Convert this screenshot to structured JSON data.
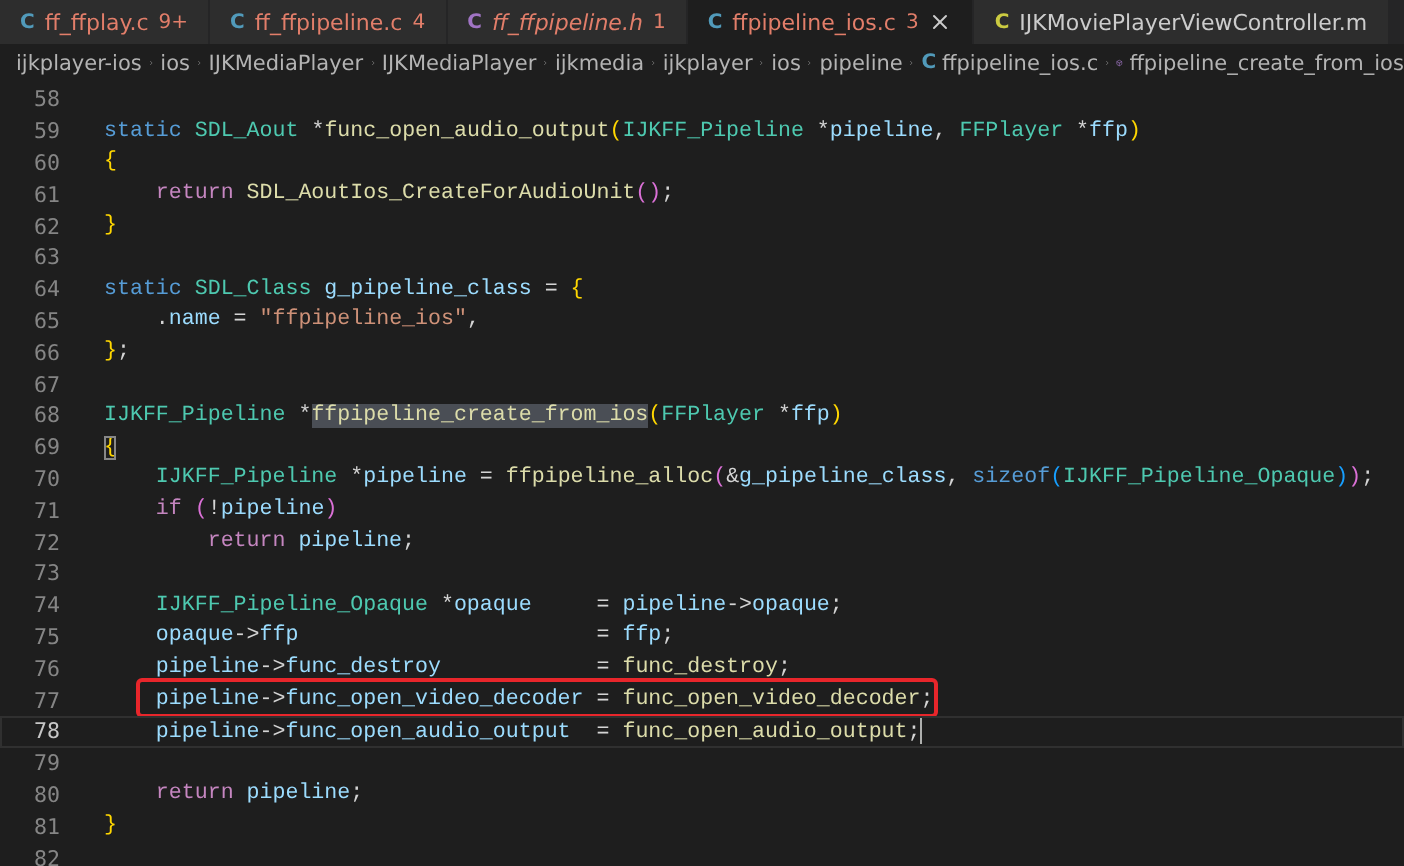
{
  "tabs": [
    {
      "icon": "C",
      "kind": "c",
      "label": "ff_ffplay.c",
      "badge": "9+",
      "has_problems": true,
      "preview": false,
      "selected": false
    },
    {
      "icon": "C",
      "kind": "c",
      "label": "ff_ffpipeline.c",
      "badge": "4",
      "has_problems": true,
      "preview": false,
      "selected": false
    },
    {
      "icon": "C",
      "kind": "h",
      "label": "ff_ffpipeline.h",
      "badge": "1",
      "has_problems": true,
      "preview": true,
      "selected": false
    },
    {
      "icon": "C",
      "kind": "c",
      "label": "ffpipeline_ios.c",
      "badge": "3",
      "has_problems": true,
      "preview": false,
      "selected": true
    },
    {
      "icon": "C",
      "kind": "m",
      "label": "IJKMoviePlayerViewController.m",
      "has_problems": false,
      "preview": false,
      "selected": false
    }
  ],
  "breadcrumb": [
    {
      "kind": "folder",
      "label": "ijkplayer-ios"
    },
    {
      "kind": "folder",
      "label": "ios"
    },
    {
      "kind": "folder",
      "label": "IJKMediaPlayer"
    },
    {
      "kind": "folder",
      "label": "IJKMediaPlayer"
    },
    {
      "kind": "folder",
      "label": "ijkmedia"
    },
    {
      "kind": "folder",
      "label": "ijkplayer"
    },
    {
      "kind": "folder",
      "label": "ios"
    },
    {
      "kind": "folder",
      "label": "pipeline"
    },
    {
      "kind": "file",
      "icon": "C",
      "label": "ffpipeline_ios.c"
    },
    {
      "kind": "symbol",
      "label": "ffpipeline_create_from_ios"
    }
  ],
  "lines": [
    {
      "n": "58",
      "current": false,
      "annotated": false
    },
    {
      "n": "59",
      "current": false,
      "annotated": false,
      "tokens": [
        {
          "text": "static",
          "kind": "kw"
        },
        {
          "text": " SDL_Aout",
          "kind": "type"
        },
        {
          "text": " *",
          "kind": "p"
        },
        {
          "text": "func_open_audio_output",
          "kind": "fn"
        },
        {
          "text": "(",
          "kind": "b1"
        },
        {
          "text": "IJKFF_Pipeline",
          "kind": "type"
        },
        {
          "text": " *",
          "kind": "p"
        },
        {
          "text": "pipeline",
          "kind": "var"
        },
        {
          "text": ",",
          "kind": "p"
        },
        {
          "text": " FFPlayer",
          "kind": "type"
        },
        {
          "text": " *",
          "kind": "p"
        },
        {
          "text": "ffp",
          "kind": "var"
        },
        {
          "text": ")",
          "kind": "b1"
        }
      ]
    },
    {
      "n": "60",
      "current": false,
      "annotated": false,
      "tokens": [
        {
          "text": "{",
          "kind": "b1"
        }
      ]
    },
    {
      "n": "61",
      "current": false,
      "annotated": false,
      "tokens": [
        {
          "text": "    return",
          "kind": "ctl"
        },
        {
          "text": " SDL_AoutIos_CreateForAudioUnit",
          "kind": "fn"
        },
        {
          "text": "()",
          "kind": "b2"
        },
        {
          "text": ";",
          "kind": "p"
        }
      ]
    },
    {
      "n": "62",
      "current": false,
      "annotated": false,
      "tokens": [
        {
          "text": "}",
          "kind": "b1"
        }
      ]
    },
    {
      "n": "63",
      "current": false,
      "annotated": false
    },
    {
      "n": "64",
      "current": false,
      "annotated": false,
      "tokens": [
        {
          "text": "static",
          "kind": "kw"
        },
        {
          "text": " SDL_Class",
          "kind": "type"
        },
        {
          "text": " g_pipeline_class",
          "kind": "var"
        },
        {
          "text": " =",
          "kind": "p"
        },
        {
          "text": " {",
          "kind": "b1"
        }
      ]
    },
    {
      "n": "65",
      "current": false,
      "annotated": false,
      "tokens": [
        {
          "text": "    .",
          "kind": "p"
        },
        {
          "text": "name",
          "kind": "var"
        },
        {
          "text": " =",
          "kind": "p"
        },
        {
          "text": " \"ffpipeline_ios\"",
          "kind": "str"
        },
        {
          "text": ",",
          "kind": "p"
        }
      ]
    },
    {
      "n": "66",
      "current": false,
      "annotated": false,
      "tokens": [
        {
          "text": "}",
          "kind": "b1"
        },
        {
          "text": ";",
          "kind": "p"
        }
      ]
    },
    {
      "n": "67",
      "current": false,
      "annotated": false
    },
    {
      "n": "68",
      "current": false,
      "annotated": false,
      "tokens": [
        {
          "text": "IJKFF_Pipeline",
          "kind": "type"
        },
        {
          "text": " *",
          "kind": "p"
        },
        {
          "text": "ffpipeline_create_from_ios",
          "kind": "sel"
        },
        {
          "text": "(",
          "kind": "b1"
        },
        {
          "text": "FFPlayer",
          "kind": "type"
        },
        {
          "text": " *",
          "kind": "p"
        },
        {
          "text": "ffp",
          "kind": "var"
        },
        {
          "text": ")",
          "kind": "b1"
        }
      ]
    },
    {
      "n": "69",
      "current": false,
      "annotated": false,
      "tokens": [
        {
          "text": "{",
          "kind": "match"
        }
      ]
    },
    {
      "n": "70",
      "current": false,
      "annotated": false,
      "tokens": [
        {
          "text": "    IJKFF_Pipeline",
          "kind": "type"
        },
        {
          "text": " *",
          "kind": "p"
        },
        {
          "text": "pipeline",
          "kind": "var"
        },
        {
          "text": " =",
          "kind": "p"
        },
        {
          "text": " ffpipeline_alloc",
          "kind": "fn"
        },
        {
          "text": "(",
          "kind": "b2"
        },
        {
          "text": "&",
          "kind": "p"
        },
        {
          "text": "g_pipeline_class",
          "kind": "var"
        },
        {
          "text": ",",
          "kind": "p"
        },
        {
          "text": " sizeof",
          "kind": "kw"
        },
        {
          "text": "(",
          "kind": "b3"
        },
        {
          "text": "IJKFF_Pipeline_Opaque",
          "kind": "type"
        },
        {
          "text": ")",
          "kind": "b3"
        },
        {
          "text": ")",
          "kind": "b2"
        },
        {
          "text": ";",
          "kind": "p"
        }
      ]
    },
    {
      "n": "71",
      "current": false,
      "annotated": false,
      "tokens": [
        {
          "text": "    if",
          "kind": "ctl"
        },
        {
          "text": " (",
          "kind": "b2"
        },
        {
          "text": "!",
          "kind": "p"
        },
        {
          "text": "pipeline",
          "kind": "var"
        },
        {
          "text": ")",
          "kind": "b2"
        }
      ]
    },
    {
      "n": "72",
      "current": false,
      "annotated": false,
      "tokens": [
        {
          "text": "        return",
          "kind": "ctl"
        },
        {
          "text": " pipeline",
          "kind": "var"
        },
        {
          "text": ";",
          "kind": "p"
        }
      ]
    },
    {
      "n": "73",
      "current": false,
      "annotated": false
    },
    {
      "n": "74",
      "current": false,
      "annotated": false,
      "tokens": [
        {
          "text": "    IJKFF_Pipeline_Opaque",
          "kind": "type"
        },
        {
          "text": " *",
          "kind": "p"
        },
        {
          "text": "opaque",
          "kind": "var"
        },
        {
          "text": "     =",
          "kind": "p"
        },
        {
          "text": " pipeline",
          "kind": "var"
        },
        {
          "text": "->",
          "kind": "p"
        },
        {
          "text": "opaque",
          "kind": "var"
        },
        {
          "text": ";",
          "kind": "p"
        }
      ]
    },
    {
      "n": "75",
      "current": false,
      "annotated": false,
      "tokens": [
        {
          "text": "    opaque",
          "kind": "var"
        },
        {
          "text": "->",
          "kind": "p"
        },
        {
          "text": "ffp",
          "kind": "var"
        },
        {
          "text": "                       =",
          "kind": "p"
        },
        {
          "text": " ffp",
          "kind": "var"
        },
        {
          "text": ";",
          "kind": "p"
        }
      ]
    },
    {
      "n": "76",
      "current": false,
      "annotated": false,
      "tokens": [
        {
          "text": "    pipeline",
          "kind": "var"
        },
        {
          "text": "->",
          "kind": "p"
        },
        {
          "text": "func_destroy",
          "kind": "var"
        },
        {
          "text": "            =",
          "kind": "p"
        },
        {
          "text": " func_destroy",
          "kind": "fn"
        },
        {
          "text": ";",
          "kind": "p"
        }
      ]
    },
    {
      "n": "77",
      "current": false,
      "annotated": true,
      "tokens": [
        {
          "text": "    pipeline",
          "kind": "var"
        },
        {
          "text": "->",
          "kind": "p"
        },
        {
          "text": "func_open_video_decoder",
          "kind": "var"
        },
        {
          "text": " =",
          "kind": "p"
        },
        {
          "text": " func_open_video_decoder",
          "kind": "fn"
        },
        {
          "text": ";",
          "kind": "p"
        }
      ]
    },
    {
      "n": "78",
      "current": true,
      "annotated": false,
      "tokens": [
        {
          "text": "    pipeline",
          "kind": "var"
        },
        {
          "text": "->",
          "kind": "p"
        },
        {
          "text": "func_open_audio_output",
          "kind": "var"
        },
        {
          "text": "  =",
          "kind": "p"
        },
        {
          "text": " func_open_audio_output",
          "kind": "fn"
        },
        {
          "text": ";",
          "kind": "p"
        }
      ]
    },
    {
      "n": "79",
      "current": false,
      "annotated": false
    },
    {
      "n": "80",
      "current": false,
      "annotated": false,
      "tokens": [
        {
          "text": "    return",
          "kind": "ctl"
        },
        {
          "text": " pipeline",
          "kind": "var"
        },
        {
          "text": ";",
          "kind": "p"
        }
      ]
    },
    {
      "n": "81",
      "current": false,
      "annotated": false,
      "tokens": [
        {
          "text": "}",
          "kind": "b1"
        }
      ]
    },
    {
      "n": "82",
      "current": false,
      "annotated": false
    }
  ]
}
